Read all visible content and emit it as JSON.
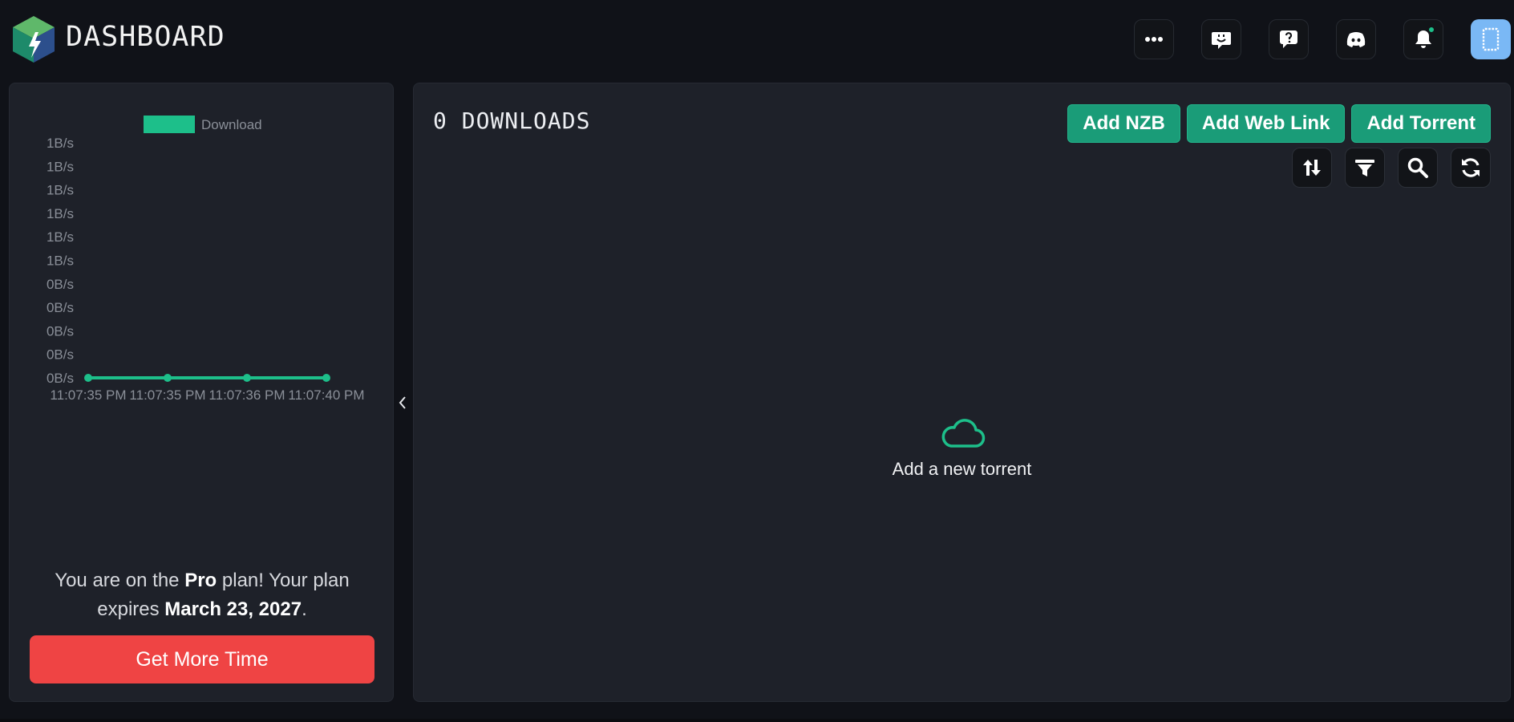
{
  "header": {
    "brand": "DASHBOARD",
    "icons": [
      "more-icon",
      "chat-icon",
      "support-icon",
      "discord-icon",
      "bell-icon",
      "user-icon"
    ],
    "accent": "#1dbf8a"
  },
  "sidebar": {
    "chart_data": {
      "type": "line",
      "legend": [
        "Download"
      ],
      "x": [
        "11:07:35 PM",
        "11:07:35 PM",
        "11:07:36 PM",
        "11:07:40 PM"
      ],
      "series": [
        {
          "name": "Download",
          "values": [
            0,
            0,
            0,
            0
          ],
          "color": "#1dbf8a"
        }
      ],
      "y_ticks": [
        "1B/s",
        "1B/s",
        "1B/s",
        "1B/s",
        "1B/s",
        "1B/s",
        "0B/s",
        "0B/s",
        "0B/s",
        "0B/s",
        "0B/s"
      ],
      "ylim": [
        0,
        1
      ],
      "grid": false,
      "legend_position": "top"
    },
    "plan": {
      "prefix": "You are on the ",
      "plan_name": "Pro",
      "middle": " plan! Your plan expires ",
      "expiry": "March 23, 2027",
      "suffix": "."
    },
    "cta_label": "Get More Time",
    "cta_color": "#ef4444"
  },
  "main": {
    "title": "0 DOWNLOADS",
    "actions": {
      "add_nzb": "Add NZB",
      "add_web_link": "Add Web Link",
      "add_torrent": "Add Torrent"
    },
    "tools": [
      "sort-icon",
      "filter-icon",
      "search-icon",
      "refresh-icon"
    ],
    "empty_state": "Add a new torrent"
  }
}
